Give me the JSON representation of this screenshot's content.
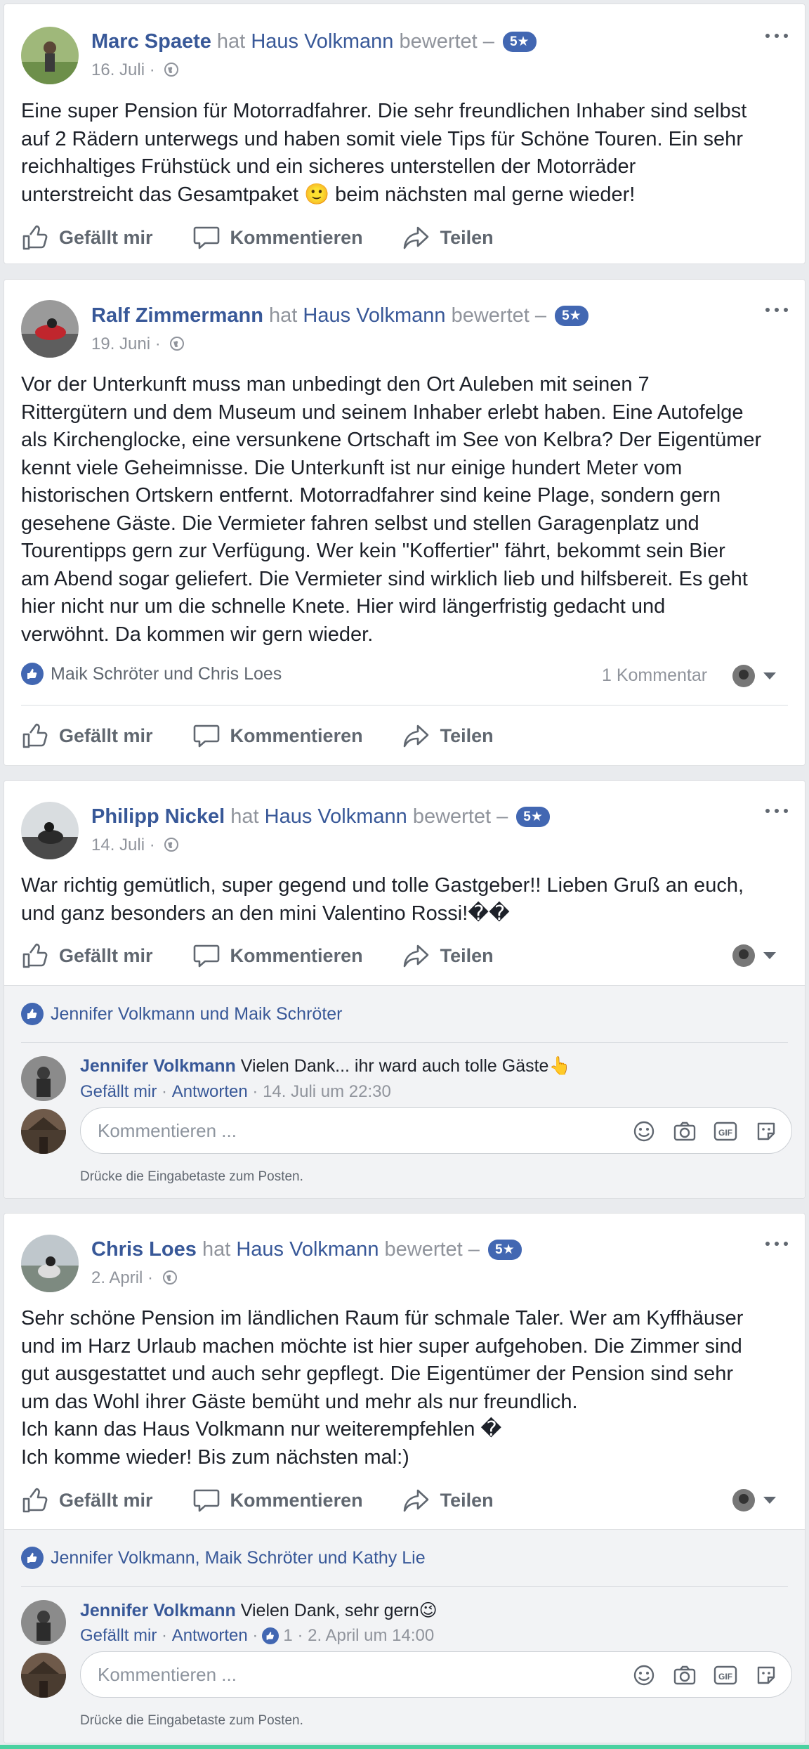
{
  "posts": [
    {
      "author": "Marc Spaete",
      "verb": "hat",
      "page": "Haus Volkmann",
      "rated": "bewertet –",
      "stars": "5★",
      "date": "16. Juli ·",
      "text": "Eine super Pension für Motorradfahrer. Die sehr freundlichen Inhaber sind selbst\nauf 2 Rädern unterwegs und haben somit viele Tips für Schöne Touren. Ein sehr\nreichhaltiges Frühstück und ein sicheres unterstellen der Motorräder\nunterstreicht das Gesamtpaket 🙂 beim nächsten mal gerne wieder!",
      "actions": {
        "like": "Gefällt mir",
        "comment": "Kommentieren",
        "share": "Teilen"
      }
    },
    {
      "author": "Ralf Zimmermann",
      "verb": "hat",
      "page": "Haus Volkmann",
      "rated": "bewertet –",
      "stars": "5★",
      "date": "19. Juni ·",
      "text": "Vor der Unterkunft muss man unbedingt den Ort Auleben mit seinen 7\nRittergütern und dem Museum und seinem Inhaber erlebt haben. Eine Autofelge\nals Kirchenglocke, eine versunkene Ortschaft im See von Kelbra? Der Eigentümer\nkennt viele Geheimnisse. Die Unterkunft ist nur einige hundert Meter vom\nhistorischen Ortskern entfernt. Motorradfahrer sind keine Plage, sondern gern\ngesehene Gäste. Die Vermieter fahren selbst und stellen Garagenplatz und\nTourentipps gern zur Verfügung. Wer kein \"Koffertier\" fährt, bekommt sein Bier\nam Abend sogar geliefert. Die Vermieter sind wirklich lieb und hilfsbereit. Es geht\nhier nicht nur um die schnelle Knete. Hier wird längerfristig gedacht und\nverwöhnt. Da kommen wir gern wieder.",
      "likes": "Maik Schröter und Chris Loes",
      "comment_count": "1 Kommentar",
      "actions": {
        "like": "Gefällt mir",
        "comment": "Kommentieren",
        "share": "Teilen"
      }
    },
    {
      "author": "Philipp Nickel",
      "verb": "hat",
      "page": "Haus Volkmann",
      "rated": "bewertet –",
      "stars": "5★",
      "date": "14. Juli ·",
      "text": "War richtig gemütlich, super gegend und tolle Gastgeber!! Lieben Gruß an euch,\nund ganz besonders an den mini Valentino Rossi!��",
      "actions": {
        "like": "Gefällt mir",
        "comment": "Kommentieren",
        "share": "Teilen"
      },
      "likes": "Jennifer Volkmann und Maik Schröter",
      "reply": {
        "author": "Jennifer Volkmann",
        "text": "Vielen Dank... ihr ward auch tolle Gäste👆",
        "like": "Gefällt mir",
        "answer": "Antworten",
        "time": "· 14. Juli um 22:30"
      },
      "input_placeholder": "Kommentieren ...",
      "hint": "Drücke die Eingabetaste zum Posten."
    },
    {
      "author": "Chris Loes",
      "verb": "hat",
      "page": "Haus Volkmann",
      "rated": "bewertet –",
      "stars": "5★",
      "date": "2. April ·",
      "text": "Sehr schöne Pension im ländlichen Raum für schmale Taler. Wer am Kyffhäuser\nund im Harz Urlaub machen möchte ist hier super aufgehoben. Die Zimmer sind\ngut ausgestattet und auch sehr gepflegt. Die Eigentümer der Pension sind sehr\num das Wohl ihrer Gäste bemüht und mehr als nur freundlich.\nIch kann das Haus Volkmann nur weiterempfehlen �\nIch komme wieder! Bis zum nächsten mal:)",
      "actions": {
        "like": "Gefällt mir",
        "comment": "Kommentieren",
        "share": "Teilen"
      },
      "likes": "Jennifer Volkmann, Maik Schröter und Kathy Lie",
      "reply": {
        "author": "Jennifer Volkmann",
        "text": "Vielen Dank, sehr gern😉",
        "like": "Gefällt mir",
        "answer": "Antworten",
        "like_count": "1",
        "time": "· 2. April um 14:00"
      },
      "input_placeholder": "Kommentieren ...",
      "hint": "Drücke die Eingabetaste zum Posten."
    }
  ],
  "colors": {
    "link": "#385898",
    "muted": "#90949c",
    "brand": "#4267b2",
    "background": "#e9ebee"
  }
}
